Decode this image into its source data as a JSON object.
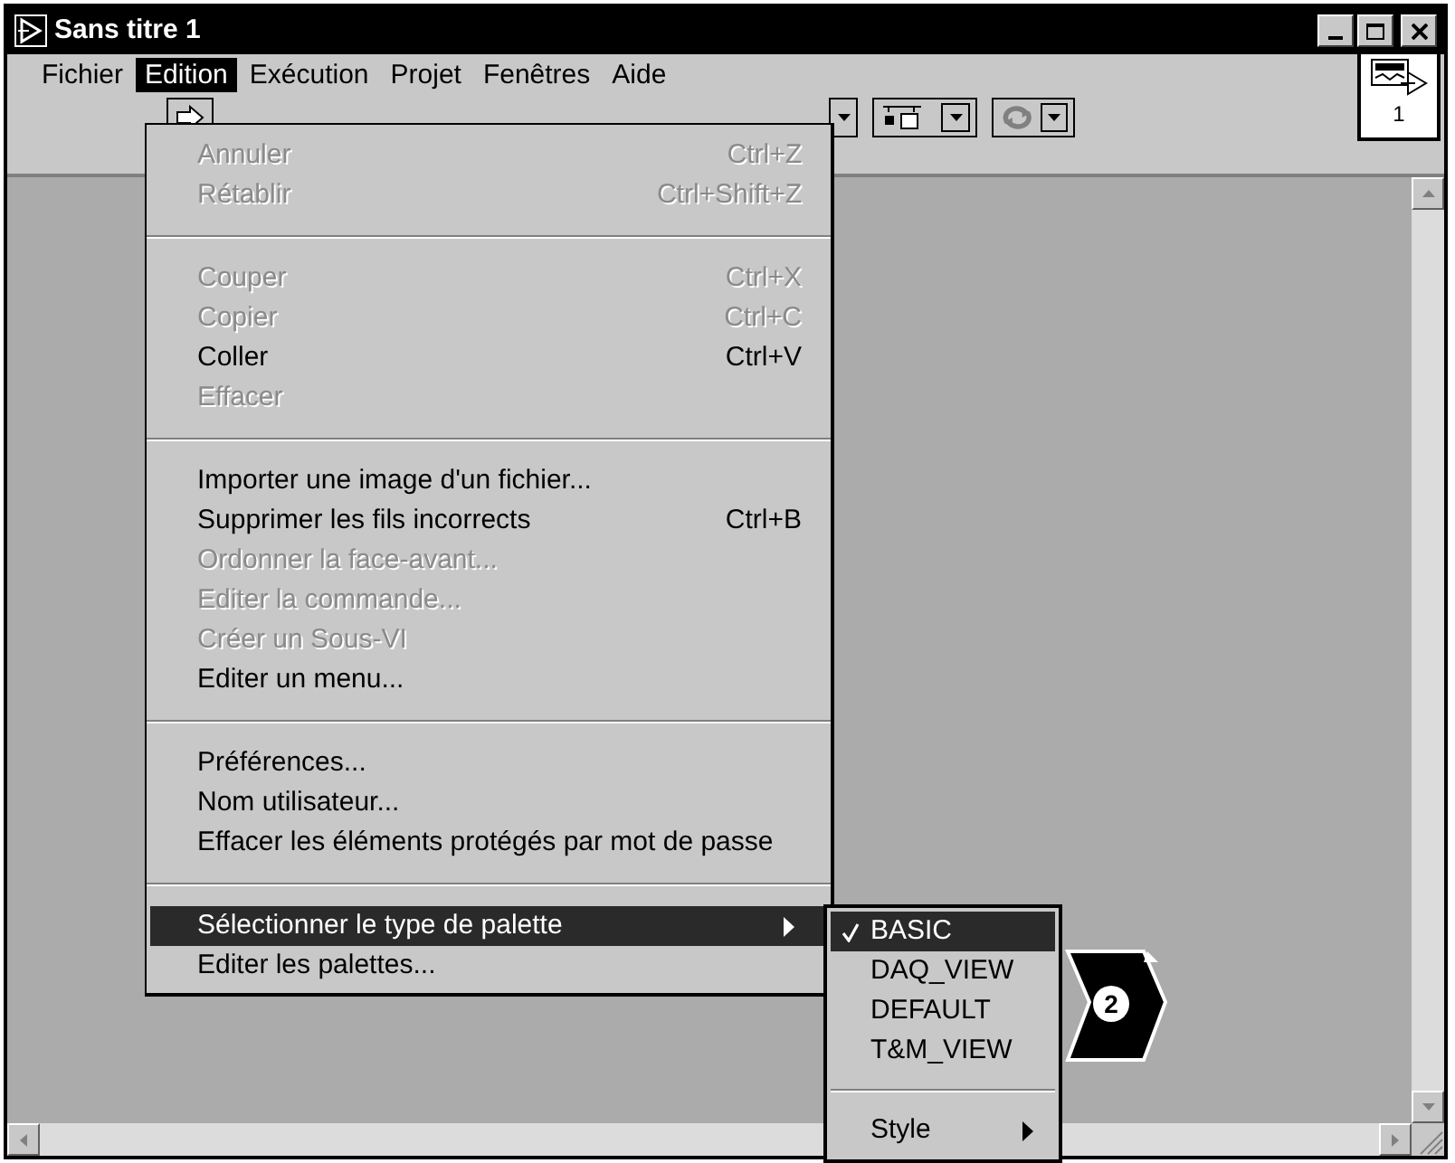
{
  "window": {
    "title": "Sans titre 1"
  },
  "menu_bar": [
    {
      "label": "Fichier",
      "selected": false
    },
    {
      "label": "Edition",
      "selected": true
    },
    {
      "label": "Exécution",
      "selected": false
    },
    {
      "label": "Projet",
      "selected": false
    },
    {
      "label": "Fenêtres",
      "selected": false
    },
    {
      "label": "Aide",
      "selected": false
    }
  ],
  "connector_pane": {
    "label": "1"
  },
  "edit_menu": [
    {
      "kind": "item",
      "label": "Annuler",
      "shortcut": "Ctrl+Z",
      "disabled": true,
      "selected": false
    },
    {
      "kind": "item",
      "label": "Rétablir",
      "shortcut": "Ctrl+Shift+Z",
      "disabled": true,
      "selected": false
    },
    {
      "kind": "separator"
    },
    {
      "kind": "item",
      "label": "Couper",
      "shortcut": "Ctrl+X",
      "disabled": true,
      "selected": false
    },
    {
      "kind": "item",
      "label": "Copier",
      "shortcut": "Ctrl+C",
      "disabled": true,
      "selected": false
    },
    {
      "kind": "item",
      "label": "Coller",
      "shortcut": "Ctrl+V",
      "disabled": false,
      "selected": false
    },
    {
      "kind": "item",
      "label": "Effacer",
      "disabled": true,
      "selected": false
    },
    {
      "kind": "separator"
    },
    {
      "kind": "item",
      "label": "Importer une image d'un fichier...",
      "disabled": false,
      "selected": false
    },
    {
      "kind": "item",
      "label": "Supprimer les fils incorrects",
      "shortcut": "Ctrl+B",
      "disabled": false,
      "selected": false
    },
    {
      "kind": "item",
      "label": "Ordonner la face-avant...",
      "disabled": true,
      "selected": false
    },
    {
      "kind": "item",
      "label": "Editer la commande...",
      "disabled": true,
      "selected": false
    },
    {
      "kind": "item",
      "label": "Créer un Sous-VI",
      "disabled": true,
      "selected": false
    },
    {
      "kind": "item",
      "label": "Editer un menu...",
      "disabled": false,
      "selected": false
    },
    {
      "kind": "separator"
    },
    {
      "kind": "item",
      "label": "Préférences...",
      "disabled": false,
      "selected": false
    },
    {
      "kind": "item",
      "label": "Nom utilisateur...",
      "disabled": false,
      "selected": false
    },
    {
      "kind": "item",
      "label": "Effacer les éléments protégés par mot de passe",
      "disabled": false,
      "selected": false
    },
    {
      "kind": "separator"
    },
    {
      "kind": "submenu",
      "label": "Sélectionner le type de palette",
      "disabled": false,
      "selected": true
    },
    {
      "kind": "item",
      "label": "Editer les palettes...",
      "disabled": false,
      "selected": false
    }
  ],
  "palette_submenu": [
    {
      "kind": "item",
      "label": "BASIC",
      "checked": true,
      "selected": true
    },
    {
      "kind": "item",
      "label": "DAQ_VIEW",
      "checked": false,
      "selected": false
    },
    {
      "kind": "item",
      "label": "DEFAULT",
      "checked": false,
      "selected": false
    },
    {
      "kind": "item",
      "label": "T&M_VIEW",
      "checked": false,
      "selected": false
    },
    {
      "kind": "separator"
    },
    {
      "kind": "submenu",
      "label": "Style",
      "checked": false,
      "selected": false
    }
  ],
  "callout": {
    "label": "2"
  }
}
